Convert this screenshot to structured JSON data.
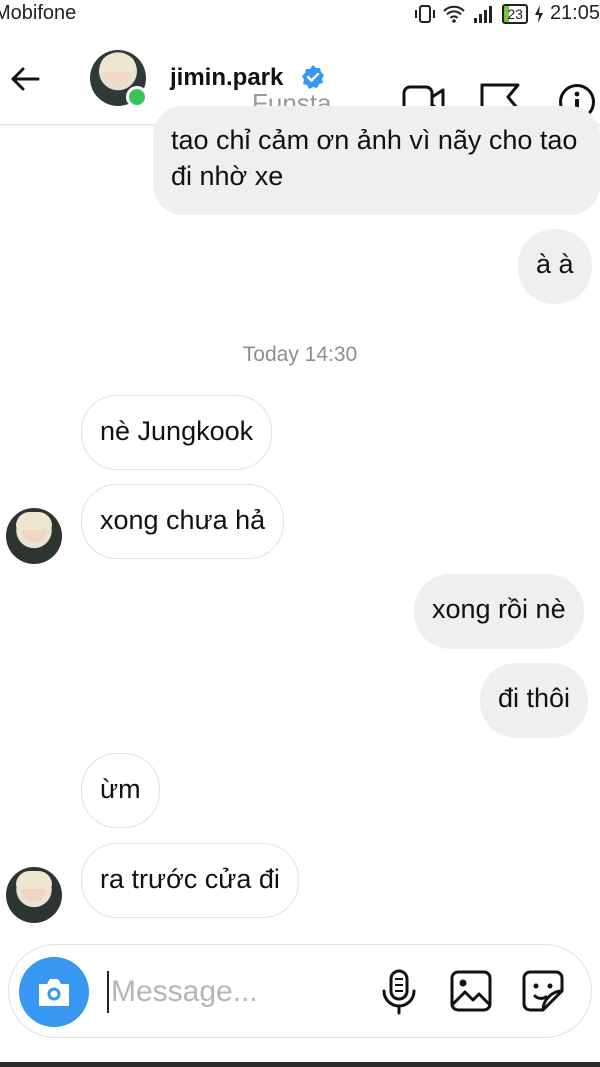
{
  "status_bar": {
    "carrier": "Mobifone",
    "battery": "23",
    "time": "21:05"
  },
  "header": {
    "username": "jimin.park",
    "subtitle": "Funsta",
    "verified_color": "#3897f0",
    "online_color": "#37c456"
  },
  "chat": {
    "timestamp": "Today 14:30",
    "messages": [
      {
        "from": "me",
        "text": "tao chỉ cảm ơn ảnh vì nãy cho tao đi nhờ xe"
      },
      {
        "from": "me",
        "text": "à à"
      },
      {
        "from": "them",
        "text": "nè Jungkook"
      },
      {
        "from": "them",
        "text": "xong chưa hả"
      },
      {
        "from": "me",
        "text": "xong rồi nè"
      },
      {
        "from": "me",
        "text": "đi thôi"
      },
      {
        "from": "them",
        "text": "ừm"
      },
      {
        "from": "them",
        "text": "ra trước cửa đi"
      }
    ]
  },
  "composer": {
    "placeholder": "Message...",
    "accent": "#3897f0"
  },
  "icons": {
    "back": "arrow-left-icon",
    "video": "video-camera-icon",
    "flag": "flag-icon",
    "info": "info-icon",
    "camera": "camera-icon",
    "mic": "microphone-icon",
    "gallery": "image-icon",
    "sticker": "sticker-icon"
  }
}
